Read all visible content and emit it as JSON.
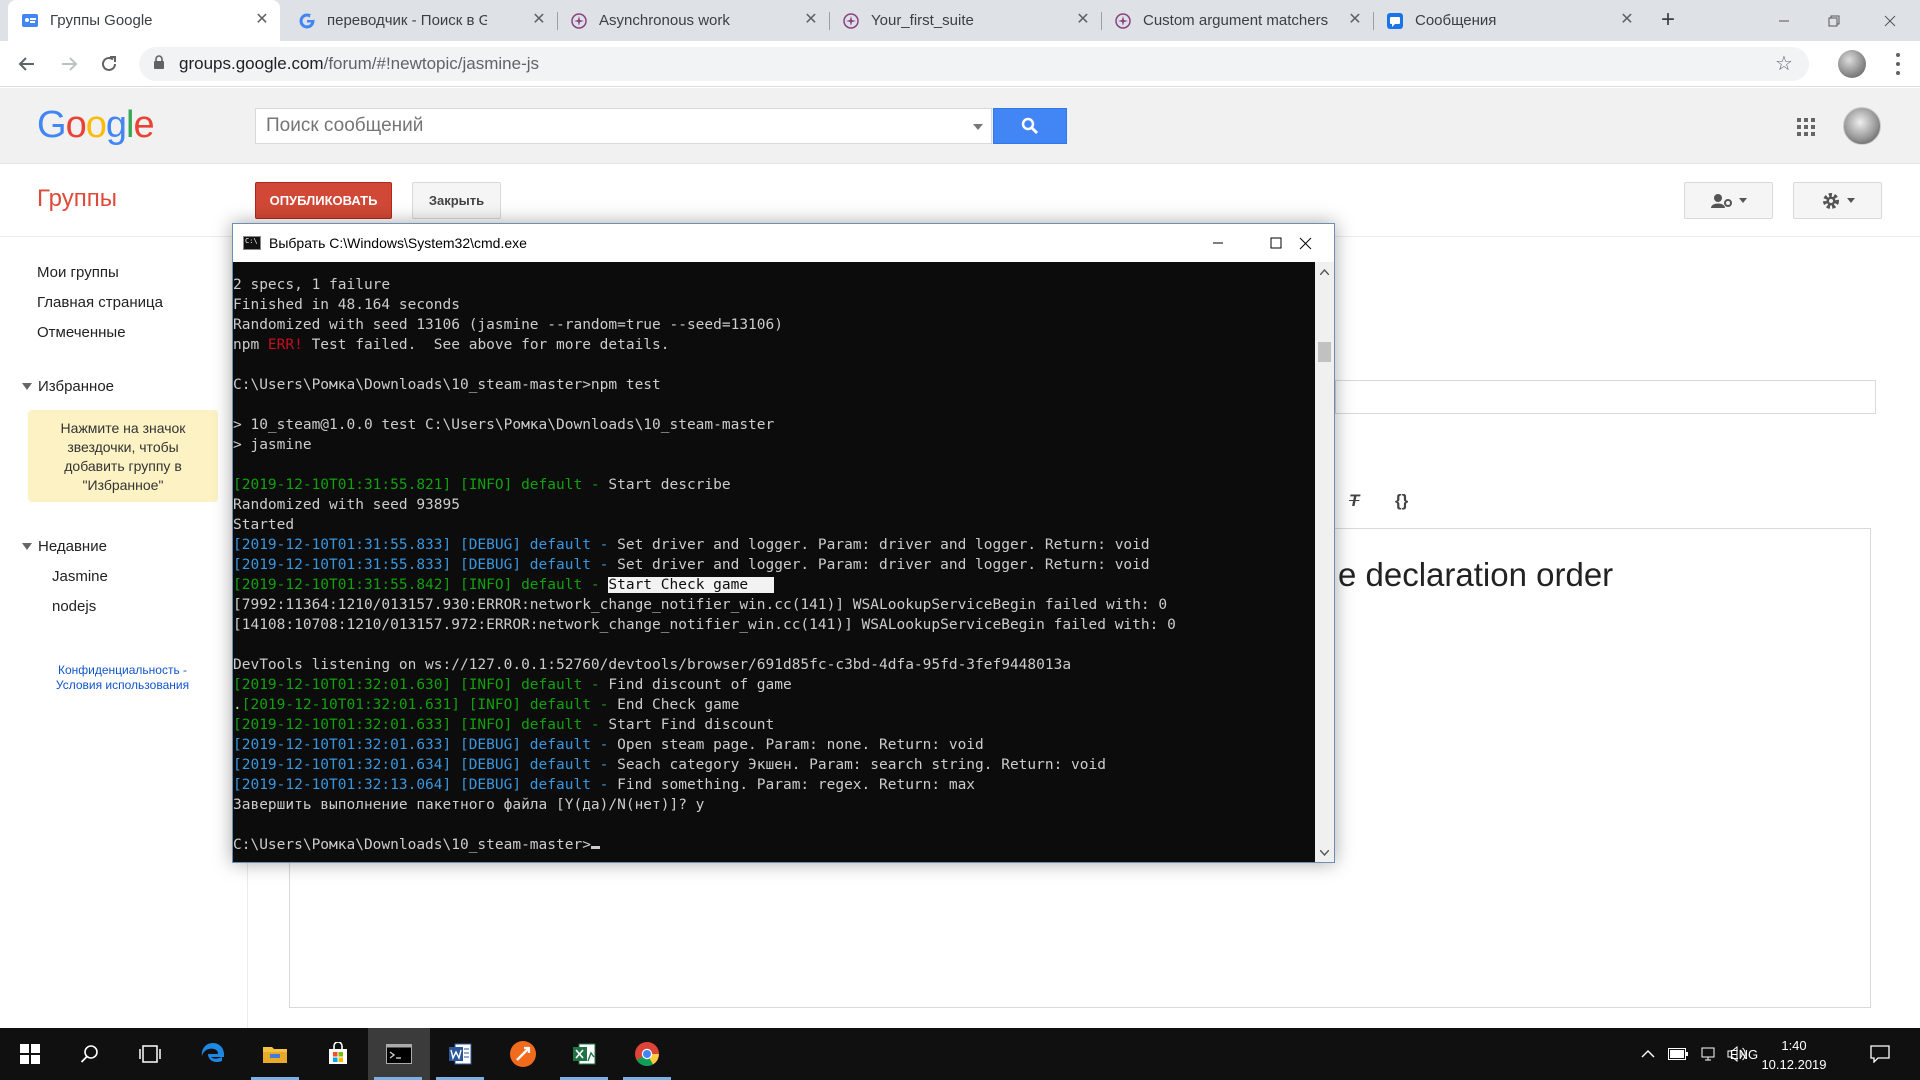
{
  "browser": {
    "tabs": [
      {
        "title": "Группы Google",
        "icon": "google-groups-icon"
      },
      {
        "title": "переводчик - Поиск в Google",
        "icon": "google-g-icon"
      },
      {
        "title": "Asynchronous work",
        "icon": "jasmine-icon"
      },
      {
        "title": "Your_first_suite",
        "icon": "jasmine-icon"
      },
      {
        "title": "Custom argument matchers",
        "icon": "jasmine-icon"
      },
      {
        "title": "Сообщения",
        "icon": "chat-icon"
      }
    ],
    "url_host": "groups.google.com",
    "url_path": "/forum/#!newtopic/jasmine-js"
  },
  "google": {
    "logo": [
      "G",
      "o",
      "o",
      "g",
      "l",
      "e"
    ],
    "logo_colors": [
      "#4285f4",
      "#ea4335",
      "#fbbc05",
      "#4285f4",
      "#34a853",
      "#ea4335"
    ],
    "search_placeholder": "Поиск сообщений"
  },
  "groups": {
    "title": "Группы",
    "publish_label": "ОПУБЛИКОВАТЬ",
    "close_label": "Закрыть"
  },
  "sidebar": {
    "items": [
      "Мои группы",
      "Главная страница",
      "Отмеченные"
    ],
    "favorites_label": "Избранное",
    "favorites_hint": "Нажмите на значок звездочки, чтобы добавить группу в \"Избранное\"",
    "recent_label": "Недавние",
    "recent_items": [
      "Jasmine",
      "nodejs"
    ],
    "footer_privacy": "Конфиденциальность -",
    "footer_terms": "Условия использования"
  },
  "editor": {
    "visible_text": "e declaration order"
  },
  "cmd": {
    "title": "Выбрать C:\\Windows\\System32\\cmd.exe",
    "lines": [
      [
        {
          "t": "2 specs, 1 failure"
        }
      ],
      [
        {
          "t": "Finished in 48.164 seconds"
        }
      ],
      [
        {
          "t": "Randomized with seed 13106 (jasmine --random=true --seed=13106)"
        }
      ],
      [
        {
          "t": "npm "
        },
        {
          "t": "ERR!",
          "c": "r"
        },
        {
          "t": " Test failed.  See above for more details."
        }
      ],
      [],
      [
        {
          "t": "C:\\Users\\Ромка\\Downloads\\10_steam-master>npm test"
        }
      ],
      [],
      [
        {
          "t": "> 10_steam@1.0.0 test C:\\Users\\Ромка\\Downloads\\10_steam-master"
        }
      ],
      [
        {
          "t": "> jasmine"
        }
      ],
      [],
      [
        {
          "t": "[2019-12-10T01:31:55.821] [INFO] default - ",
          "c": "g"
        },
        {
          "t": "Start describe"
        }
      ],
      [
        {
          "t": "Randomized with seed 93895"
        }
      ],
      [
        {
          "t": "Started"
        }
      ],
      [
        {
          "t": "[2019-12-10T01:31:55.833] [DEBUG] default - ",
          "c": "c"
        },
        {
          "t": "Set driver and logger. Param: driver and logger. Return: void"
        }
      ],
      [
        {
          "t": "[2019-12-10T01:31:55.833] [DEBUG] default - ",
          "c": "c"
        },
        {
          "t": "Set driver and logger. Param: driver and logger. Return: void"
        }
      ],
      [
        {
          "t": "[2019-12-10T01:31:55.842] [INFO] default - ",
          "c": "g"
        },
        {
          "t": "Start Check game   ",
          "c": "sel"
        }
      ],
      [
        {
          "t": "[7992:11364:1210/013157.930:ERROR:network_change_notifier_win.cc(141)] WSALookupServiceBegin failed with: 0"
        }
      ],
      [
        {
          "t": "[14108:10708:1210/013157.972:ERROR:network_change_notifier_win.cc(141)] WSALookupServiceBegin failed with: 0"
        }
      ],
      [],
      [
        {
          "t": "DevTools listening on ws://127.0.0.1:52760/devtools/browser/691d85fc-c3bd-4dfa-95fd-3fef9448013a"
        }
      ],
      [
        {
          "t": "[2019-12-10T01:32:01.630] [INFO] default - ",
          "c": "g"
        },
        {
          "t": "Find discount of game"
        }
      ],
      [
        {
          "t": "."
        },
        {
          "t": "[2019-12-10T01:32:01.631] [INFO] default - ",
          "c": "g"
        },
        {
          "t": "End Check game"
        }
      ],
      [
        {
          "t": "[2019-12-10T01:32:01.633] [INFO] default - ",
          "c": "g"
        },
        {
          "t": "Start Find discount"
        }
      ],
      [
        {
          "t": "[2019-12-10T01:32:01.633] [DEBUG] default - ",
          "c": "c"
        },
        {
          "t": "Open steam page. Param: none. Return: void"
        }
      ],
      [
        {
          "t": "[2019-12-10T01:32:01.634] [DEBUG] default - ",
          "c": "c"
        },
        {
          "t": "Seach category Экшен. Param: search string. Return: void"
        }
      ],
      [
        {
          "t": "[2019-12-10T01:32:13.064] [DEBUG] default - ",
          "c": "c"
        },
        {
          "t": "Find something. Param: regex. Return: max"
        }
      ],
      [
        {
          "t": "Завершить выполнение пакетного файла [Y(да)/N(нет)]? y"
        }
      ],
      [],
      [
        {
          "t": "C:\\Users\\Ромка\\Downloads\\10_steam-master>"
        }
      ]
    ]
  },
  "taskbar": {
    "apps": [
      "start-icon",
      "search-icon",
      "task-view-icon",
      "edge-icon",
      "file-explorer-icon",
      "store-icon",
      "cmd-icon",
      "word-icon",
      "app-orange-icon",
      "excel-icon",
      "chrome-icon"
    ],
    "lang": "ENG",
    "time": "1:40",
    "date": "10.12.2019"
  },
  "colors": {
    "google_blue": "#4285f4",
    "groups_red": "#dd4b39",
    "publish_red": "#d14836",
    "console_bg": "#0c0c0c",
    "console_green": "#13a10e",
    "console_cyan": "#3a96dd",
    "console_red": "#c50f1f"
  }
}
